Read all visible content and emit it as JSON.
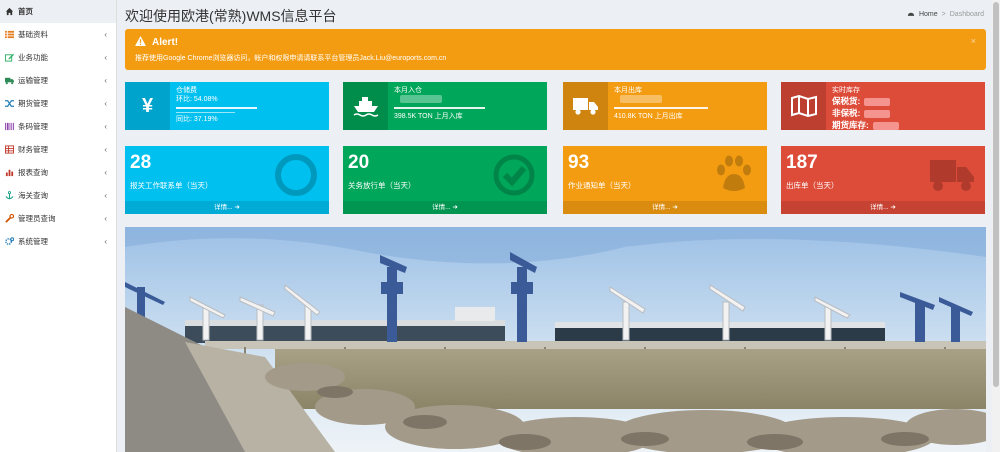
{
  "sidebar": {
    "items": [
      {
        "label": "首页",
        "icon": "home-icon",
        "color": "#333333"
      },
      {
        "label": "基础资料",
        "icon": "list-icon",
        "color": "#e67e22"
      },
      {
        "label": "业务功能",
        "icon": "edit-icon",
        "color": "#27ae60"
      },
      {
        "label": "运输管理",
        "icon": "truck-icon",
        "color": "#2e8b57"
      },
      {
        "label": "期货管理",
        "icon": "shuffle-icon",
        "color": "#2980b9"
      },
      {
        "label": "条码管理",
        "icon": "barcode-icon",
        "color": "#8e44ad"
      },
      {
        "label": "财务管理",
        "icon": "table-icon",
        "color": "#c0392b"
      },
      {
        "label": "报表查询",
        "icon": "bar-chart-icon",
        "color": "#c0392b"
      },
      {
        "label": "海关查询",
        "icon": "anchor-icon",
        "color": "#16a085"
      },
      {
        "label": "管理员查询",
        "icon": "wrench-icon",
        "color": "#d35400"
      },
      {
        "label": "系统管理",
        "icon": "cogs-icon",
        "color": "#2980b9"
      }
    ]
  },
  "header": {
    "title": "欢迎使用欧港(常熟)WMS信息平台",
    "breadcrumb_home": "Home",
    "breadcrumb_current": "Dashboard"
  },
  "alert": {
    "title": "Alert!",
    "message": "推荐使用Google Chrome浏览器访问，帐户和权限申请请联系平台管理员Jack.Liu@euroports.com.cn",
    "close": "×"
  },
  "infoboxes": {
    "storage": {
      "title": "仓储费",
      "ring_label": "环比: 54.08%",
      "yoy_label": "同比: 37.19%",
      "icon_char": "¥",
      "color": "#00c0ef"
    },
    "inbound": {
      "title": "本月入仓",
      "sub": "398.5K TON 上月入库",
      "color": "#00a65a"
    },
    "outbound": {
      "title": "本月出库",
      "sub": "410.8K TON 上月出库",
      "color": "#f39c12"
    },
    "stock": {
      "title": "实时库存",
      "lines": [
        "保税货:",
        "非保税:",
        "期货库存:"
      ],
      "color": "#dd4b39"
    }
  },
  "smallboxes": [
    {
      "number": "28",
      "label": "报关工作联系单（当天）",
      "footer": "详情...",
      "icon": "circle-ring-icon",
      "color": "#00c0ef"
    },
    {
      "number": "20",
      "label": "关务放行单（当天）",
      "footer": "详情...",
      "icon": "check-circle-icon",
      "color": "#00a65a"
    },
    {
      "number": "93",
      "label": "作业通知单（当天）",
      "footer": "详情...",
      "icon": "paw-icon",
      "color": "#f39c12"
    },
    {
      "number": "187",
      "label": "出库单（当天）",
      "footer": "详情...",
      "icon": "truck-icon",
      "color": "#dd4b39"
    }
  ]
}
